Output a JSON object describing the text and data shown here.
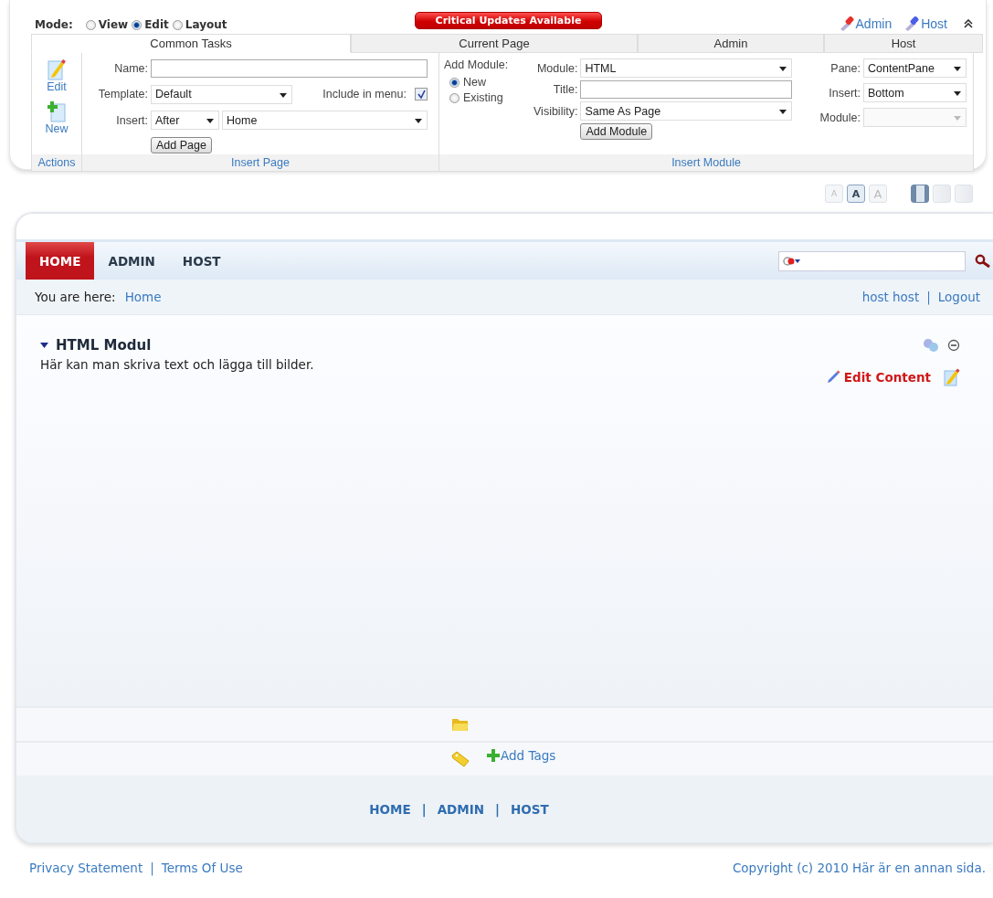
{
  "control_panel": {
    "mode_label": "Mode:",
    "modes": [
      {
        "label": "View",
        "selected": false
      },
      {
        "label": "Edit",
        "selected": true
      },
      {
        "label": "Layout",
        "selected": false
      }
    ],
    "critical_updates": "Critical Updates Available",
    "top_links": [
      {
        "label": "Admin",
        "kind": "admin"
      },
      {
        "label": "Host",
        "kind": "host"
      }
    ],
    "tabs": [
      {
        "label": "Common Tasks",
        "selected": true
      },
      {
        "label": "Current Page",
        "selected": false
      },
      {
        "label": "Admin",
        "selected": false
      },
      {
        "label": "Host",
        "selected": false
      }
    ],
    "actions": [
      {
        "label": "Edit",
        "kind": "edit"
      },
      {
        "label": "New",
        "kind": "new"
      }
    ],
    "actions_caption": "Actions",
    "insert_page": {
      "name_label": "Name:",
      "template_label": "Template:",
      "template_value": "Default",
      "include_label": "Include in menu:",
      "include_checked": true,
      "insert_label": "Insert:",
      "position_value": "After",
      "page_value": "Home",
      "button": "Add Page",
      "caption": "Insert Page"
    },
    "insert_module": {
      "add_label": "Add Module:",
      "choices": [
        {
          "label": "New",
          "selected": true
        },
        {
          "label": "Existing",
          "selected": false
        }
      ],
      "module_label": "Module:",
      "module_value": "HTML",
      "title_label": "Title:",
      "visibility_label": "Visibility:",
      "visibility_value": "Same As Page",
      "button": "Add Module",
      "pane_label": "Pane:",
      "pane_value": "ContentPane",
      "insert_label": "Insert:",
      "insert_value": "Bottom",
      "module2_label": "Module:",
      "module2_disabled": true,
      "caption": "Insert Module"
    }
  },
  "text_sizes": [
    {
      "label": "A",
      "selected": false
    },
    {
      "label": "A",
      "selected": true
    },
    {
      "label": "A",
      "selected": false
    }
  ],
  "widths": [
    {
      "selected": true
    },
    {
      "selected": false
    },
    {
      "selected": false
    }
  ],
  "nav": [
    {
      "label": "HOME",
      "selected": true
    },
    {
      "label": "ADMIN",
      "selected": false
    },
    {
      "label": "HOST",
      "selected": false
    }
  ],
  "breadcrumb": {
    "label": "You are here:",
    "link": "Home"
  },
  "user_links": {
    "user": "host host",
    "separator": "|",
    "logout": "Logout"
  },
  "module": {
    "title": "HTML Modul",
    "body": "Här kan man skriva text och lägga till bilder.",
    "edit_content": "Edit Content"
  },
  "add_tags": "Add Tags",
  "footer_nav": {
    "links": [
      "HOME",
      "ADMIN",
      "HOST"
    ],
    "separator": "|"
  },
  "page_footer": {
    "privacy": "Privacy Statement",
    "separator": "|",
    "terms": "Terms Of Use",
    "copyright": "Copyright (c) 2010 Här är en annan sida."
  }
}
